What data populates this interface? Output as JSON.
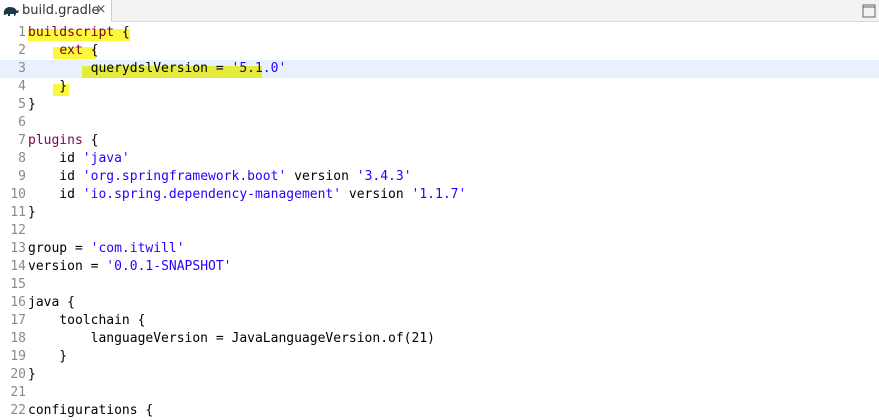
{
  "tab": {
    "title": "build.gradle",
    "close_symbol": "×",
    "icon": "gradle-elephant-icon"
  },
  "toolbar": {
    "maximize_icon": "maximize-icon"
  },
  "colors": {
    "keyword": "#7f0055",
    "string": "#2a00ff",
    "highlight": "#fbf71a",
    "current_line": "#e8f2fe"
  },
  "lines": [
    {
      "n": "1",
      "segs": [
        {
          "t": "buildscript",
          "c": "kw"
        },
        {
          "t": " {",
          "c": ""
        }
      ]
    },
    {
      "n": "2",
      "segs": [
        {
          "t": "    ",
          "c": ""
        },
        {
          "t": "ext",
          "c": "kw"
        },
        {
          "t": " {",
          "c": ""
        }
      ]
    },
    {
      "n": "3",
      "segs": [
        {
          "t": "        querydslVersion = ",
          "c": ""
        },
        {
          "t": "'5.1.0'",
          "c": "str"
        }
      ]
    },
    {
      "n": "4",
      "segs": [
        {
          "t": "    }",
          "c": ""
        }
      ]
    },
    {
      "n": "5",
      "segs": [
        {
          "t": "}",
          "c": ""
        }
      ]
    },
    {
      "n": "6",
      "segs": []
    },
    {
      "n": "7",
      "segs": [
        {
          "t": "plugins",
          "c": "kw"
        },
        {
          "t": " {",
          "c": ""
        }
      ]
    },
    {
      "n": "8",
      "segs": [
        {
          "t": "    id ",
          "c": ""
        },
        {
          "t": "'java'",
          "c": "str"
        }
      ]
    },
    {
      "n": "9",
      "segs": [
        {
          "t": "    id ",
          "c": ""
        },
        {
          "t": "'org.springframework.boot'",
          "c": "str"
        },
        {
          "t": " version ",
          "c": ""
        },
        {
          "t": "'3.4.3'",
          "c": "str"
        }
      ]
    },
    {
      "n": "10",
      "segs": [
        {
          "t": "    id ",
          "c": ""
        },
        {
          "t": "'io.spring.dependency-management'",
          "c": "str"
        },
        {
          "t": " version ",
          "c": ""
        },
        {
          "t": "'1.1.7'",
          "c": "str"
        }
      ]
    },
    {
      "n": "11",
      "segs": [
        {
          "t": "}",
          "c": ""
        }
      ]
    },
    {
      "n": "12",
      "segs": []
    },
    {
      "n": "13",
      "segs": [
        {
          "t": "group = ",
          "c": ""
        },
        {
          "t": "'com.itwill'",
          "c": "str"
        }
      ]
    },
    {
      "n": "14",
      "segs": [
        {
          "t": "version = ",
          "c": ""
        },
        {
          "t": "'0.0.1-SNAPSHOT'",
          "c": "str"
        }
      ]
    },
    {
      "n": "15",
      "segs": []
    },
    {
      "n": "16",
      "segs": [
        {
          "t": "java {",
          "c": ""
        }
      ]
    },
    {
      "n": "17",
      "segs": [
        {
          "t": "    toolchain {",
          "c": ""
        }
      ]
    },
    {
      "n": "18",
      "segs": [
        {
          "t": "        languageVersion = JavaLanguageVersion.of(21)",
          "c": ""
        }
      ]
    },
    {
      "n": "19",
      "segs": [
        {
          "t": "    }",
          "c": ""
        }
      ]
    },
    {
      "n": "20",
      "segs": [
        {
          "t": "}",
          "c": ""
        }
      ]
    },
    {
      "n": "21",
      "segs": []
    },
    {
      "n": "22",
      "segs": [
        {
          "t": "configurations {",
          "c": ""
        }
      ]
    }
  ]
}
